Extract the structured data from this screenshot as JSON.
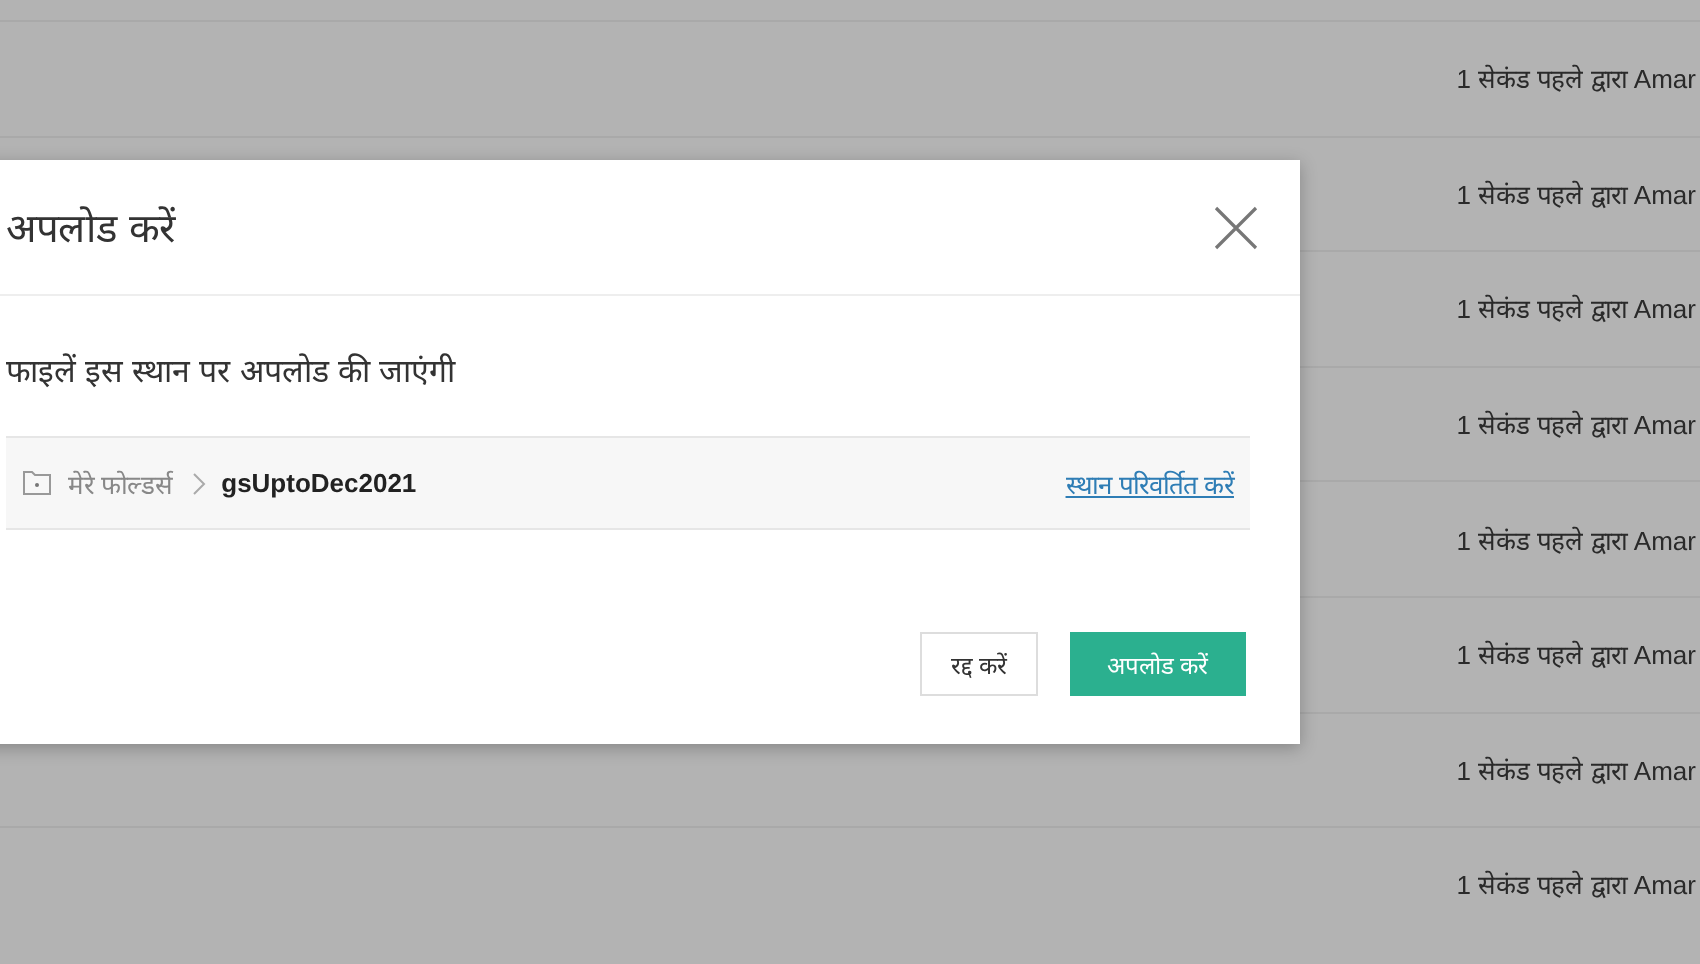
{
  "list": {
    "rows": [
      {
        "modified": "1 सेकंड पहले द्वारा Amar"
      },
      {
        "modified": "1 सेकंड पहले द्वारा Amar"
      },
      {
        "modified": "1 सेकंड पहले द्वारा Amar"
      },
      {
        "modified": "1 सेकंड पहले द्वारा Amar"
      },
      {
        "modified": "1 सेकंड पहले द्वारा Amar"
      },
      {
        "modified": "1 सेकंड पहले द्वारा Amar"
      },
      {
        "modified": "1 सेकंड पहले द्वारा Amar"
      },
      {
        "modified": "1 सेकंड पहले द्वारा Amar"
      }
    ]
  },
  "dialog": {
    "title": "अपलोड करें",
    "message": "फाइलें इस स्थान पर अपलोड की जाएंगी",
    "path": [
      {
        "label": "मेरे फोल्डर्स",
        "current": false
      },
      {
        "label": "gsUptoDec2021",
        "current": true
      }
    ],
    "change_link": "स्थान परिवर्तित करें",
    "buttons": [
      {
        "label": "रद्द करें",
        "kind": "secondary"
      },
      {
        "label": "अपलोड करें",
        "kind": "primary"
      }
    ]
  }
}
